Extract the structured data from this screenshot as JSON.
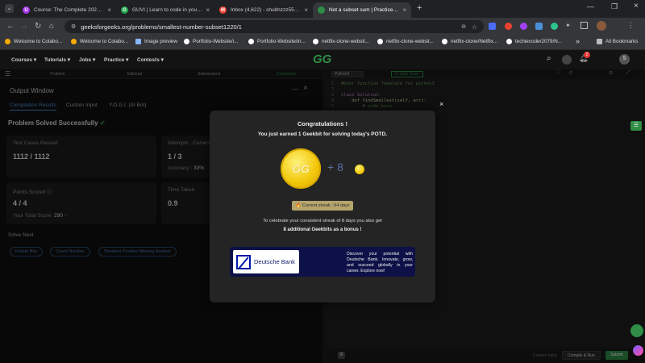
{
  "tabs": [
    {
      "title": "Course: The Complete 2024 We",
      "fav": "U",
      "color": "#a435f0"
    },
    {
      "title": "GUVI | Learn to code in your na",
      "fav": "G",
      "color": "#1ea84b"
    },
    {
      "title": "Inbox (4,622) - shubhzzz55577",
      "fav": "M",
      "color": "#ea4335"
    },
    {
      "title": "Not a subset sum | Practice | G",
      "fav": "gfg",
      "color": "#2f8d46",
      "active": true
    }
  ],
  "address": {
    "url": "geeksforgeeks.org/problems/smallest-number-subset1220/1"
  },
  "bookmarks": [
    {
      "label": "Welcome to Colabo...",
      "color": "#f9ab00"
    },
    {
      "label": "Welcome to Colabo...",
      "color": "#f9ab00"
    },
    {
      "label": "Image preview",
      "color": "#8ab4f8"
    },
    {
      "label": "Portfolio-Website/i...",
      "color": "#ffffff"
    },
    {
      "label": "Portfolio-Website/in...",
      "color": "#ffffff"
    },
    {
      "label": "netflix-clone-websit...",
      "color": "#ffffff"
    },
    {
      "label": "netflix-clone-websit...",
      "color": "#ffffff"
    },
    {
      "label": "netflix-clone/Netflix...",
      "color": "#ffffff"
    },
    {
      "label": "techiecoder2079/N...",
      "color": "#ffffff"
    }
  ],
  "bookmarks_more": "»",
  "bookmarks_all": "All Bookmarks",
  "gfg_menu": [
    "Courses ▾",
    "Tutorials ▾",
    "Jobs ▾",
    "Practice ▾",
    "Contests ▾"
  ],
  "gfg_logo": "GG",
  "notification_count": "2",
  "avatar_letter": "S",
  "problem_tabs": [
    "Problem",
    "Editorial",
    "Submissions",
    "Comments"
  ],
  "output": {
    "title": "Output Window",
    "tabs": [
      "Compilation Results",
      "Custom Input",
      "Y.O.G.I. (AI Bot)"
    ],
    "status": "Problem Solved Successfully",
    "test_cases_label": "Test Cases Passed",
    "test_cases_value": "1112 / 1112",
    "attempts_label": "Attempts : Correct / ...",
    "attempts_value": "1 / 3",
    "accuracy_label": "Accuracy :",
    "accuracy_value": "33%",
    "points_label": "Points Scored",
    "points_value": "4 / 4",
    "total_score_label": "Your Total Score:",
    "total_score_value": "290",
    "time_label": "Time Taken",
    "time_value": "0.9",
    "solve_next_label": "Solve Next",
    "solve_next": [
      "Rotate Bits",
      "Count Number",
      "Smallest Positive Missing Number"
    ]
  },
  "editor": {
    "language": "Python3",
    "start_timer": "Start Timer",
    "lines": [
      {
        "n": "1",
        "text": "#User function Template for python3",
        "color": "#6a9955"
      },
      {
        "n": "2",
        "text": "",
        "color": "#ccc"
      },
      {
        "n": "3",
        "text": "class Solution:",
        "color": "#c586c0"
      },
      {
        "n": "4",
        "text": "    def findSmallest(self, arr):",
        "color": "#dcdcaa"
      },
      {
        "n": "5",
        "text": "        # code here",
        "color": "#6a9955"
      }
    ],
    "custom_input": "Custom Input",
    "compile": "Compile & Run",
    "submit": "Submit"
  },
  "modal": {
    "title": "Congratulations !",
    "subtitle": "You just earned 1 Geekbit for solving today's POTD.",
    "coin_label": "GG",
    "plus_text": "+ 8",
    "streak": "🔥 Current streak : 64 days",
    "message": "To celebrate your consistent streak of 8 days you also get",
    "bonus": "8 additional Geekbits as a bonus !",
    "ad_brand": "Deutsche Bank",
    "ad_text": "Discover your potential with Deutsche Bank. Innovate, grow, and succeed globally in your career. Explore now!",
    "close": "×"
  },
  "colors": {
    "accent": "#2f8d46",
    "coin": "#f3c80b",
    "ad_bg": "#0d1147"
  }
}
